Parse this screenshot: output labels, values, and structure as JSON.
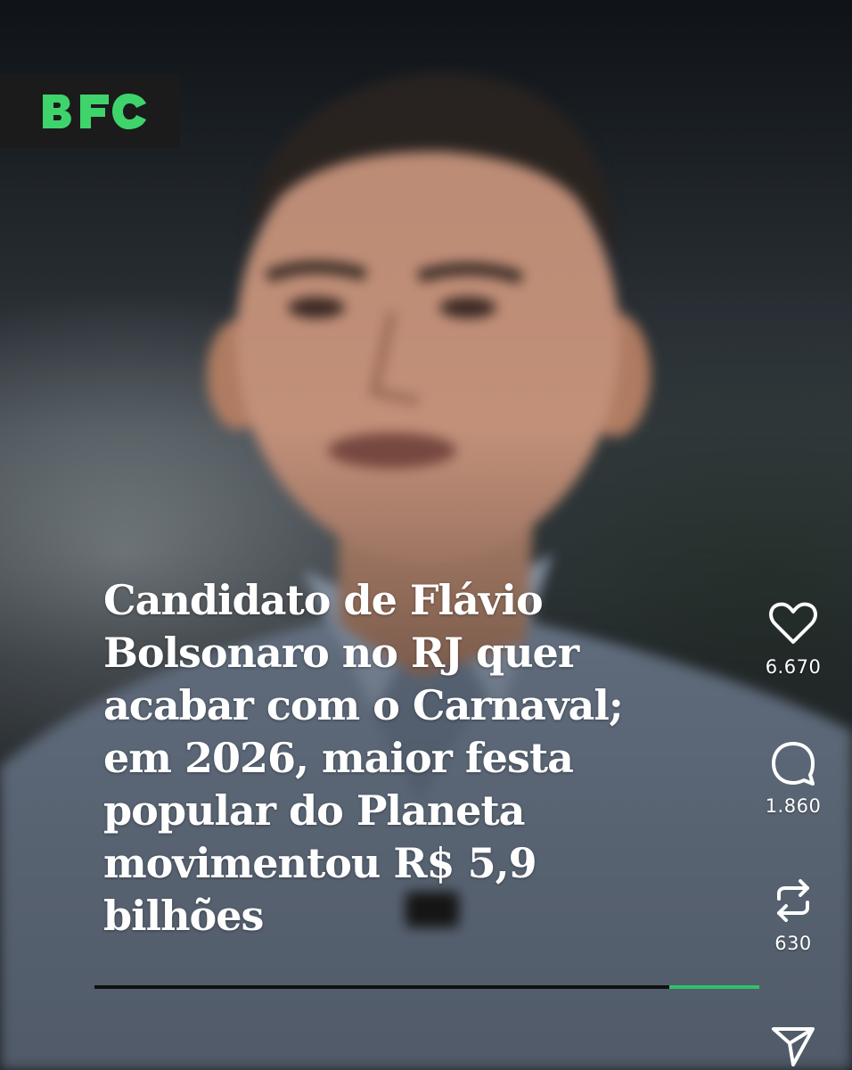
{
  "logo": {
    "text": "BFC",
    "color": "#3fd36b",
    "background": "#1b1b1b"
  },
  "post": {
    "headline": "Candidato de Flávio\nBolsonaro no RJ quer\nacabar com o Carnaval;\nem 2026, maior festa\npopular do Planeta\nmovimentou R$ 5,9\nbilhões"
  },
  "video": {
    "progress": 0.865,
    "progress_color": "#2ec26a"
  },
  "actions": {
    "like": {
      "icon": "heart-icon",
      "count": "6.670"
    },
    "comment": {
      "icon": "speech-bubble-icon",
      "count": "1.860"
    },
    "repost": {
      "icon": "repost-arrows-icon",
      "count": "630"
    },
    "share": {
      "icon": "paper-plane-icon"
    }
  }
}
